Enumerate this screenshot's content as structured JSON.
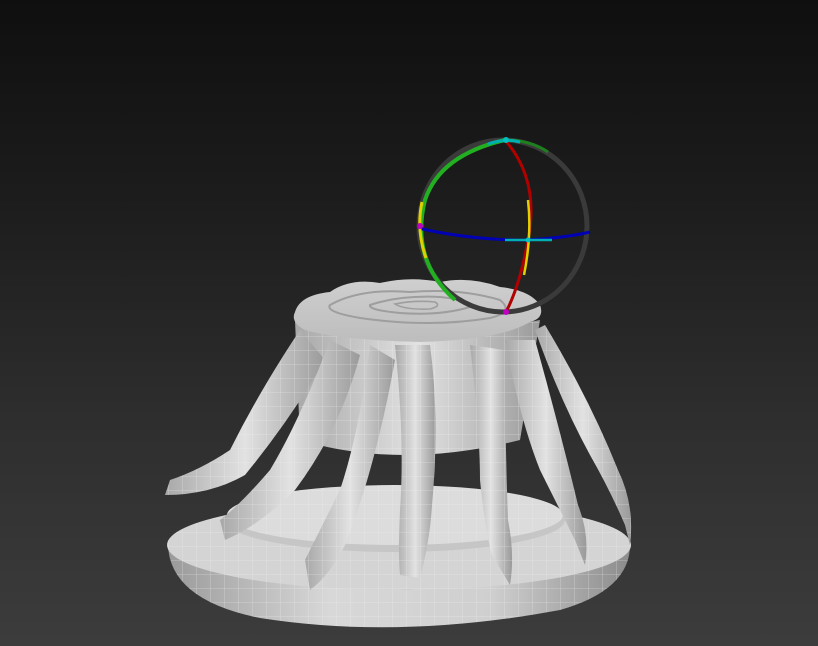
{
  "viewport": {
    "background_top": "#0f0f0f",
    "background_bottom": "#3c3c3c"
  },
  "model": {
    "mesh_color": "#d9d9d9",
    "wire_color": "#f4f4f4",
    "shadow_color": "#8a8a8a"
  },
  "gizmo": {
    "ring_x_color": "#c00000",
    "ring_y_color": "#00a000",
    "ring_z_color": "#0000c0",
    "axis_color": "#e0d000",
    "accent_color": "#00b0b0",
    "outer_ring_color": "#3a3a3a"
  }
}
